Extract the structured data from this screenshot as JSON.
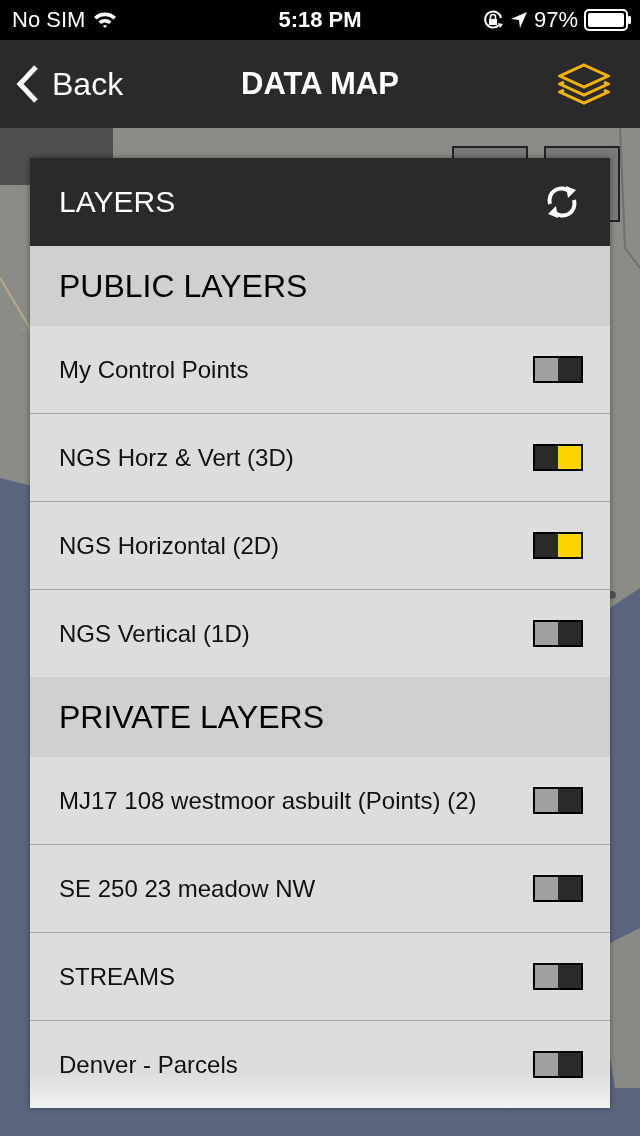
{
  "status_bar": {
    "carrier": "No SIM",
    "time": "5:18 PM",
    "battery": "97%"
  },
  "nav_bar": {
    "back": "Back",
    "title": "DATA MAP"
  },
  "layers_panel": {
    "title": "LAYERS",
    "sections": [
      {
        "title": "PUBLIC LAYERS",
        "items": [
          {
            "label": "My Control Points",
            "on": false
          },
          {
            "label": "NGS Horz & Vert (3D)",
            "on": true
          },
          {
            "label": "NGS Horizontal (2D)",
            "on": true
          },
          {
            "label": "NGS Vertical (1D)",
            "on": false
          }
        ]
      },
      {
        "title": "PRIVATE LAYERS",
        "items": [
          {
            "label": "MJ17 108 westmoor asbuilt (Points) (2)",
            "on": false
          },
          {
            "label": "SE 250 23 meadow NW",
            "on": false
          },
          {
            "label": "STREAMS",
            "on": false
          },
          {
            "label": "Denver - Parcels",
            "on": false
          }
        ]
      }
    ]
  }
}
